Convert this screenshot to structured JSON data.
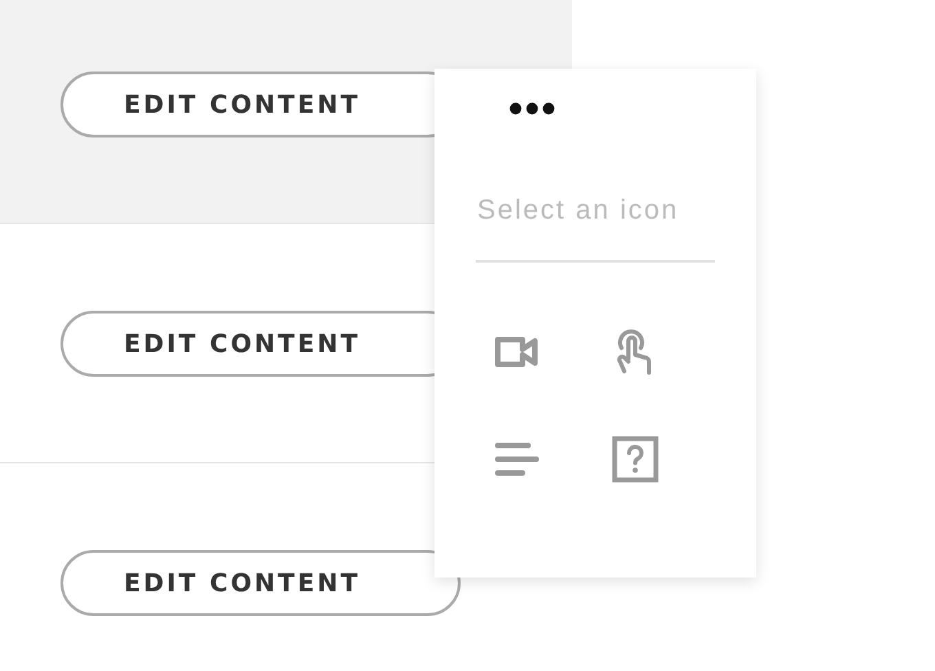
{
  "rows": [
    {
      "button": "EDIT CONTENT",
      "selected": true
    },
    {
      "button": "EDIT CONTENT",
      "selected": false
    },
    {
      "button": "EDIT CONTENT",
      "selected": false
    }
  ],
  "icon_picker": {
    "search": {
      "placeholder": "Select an icon"
    }
  }
}
